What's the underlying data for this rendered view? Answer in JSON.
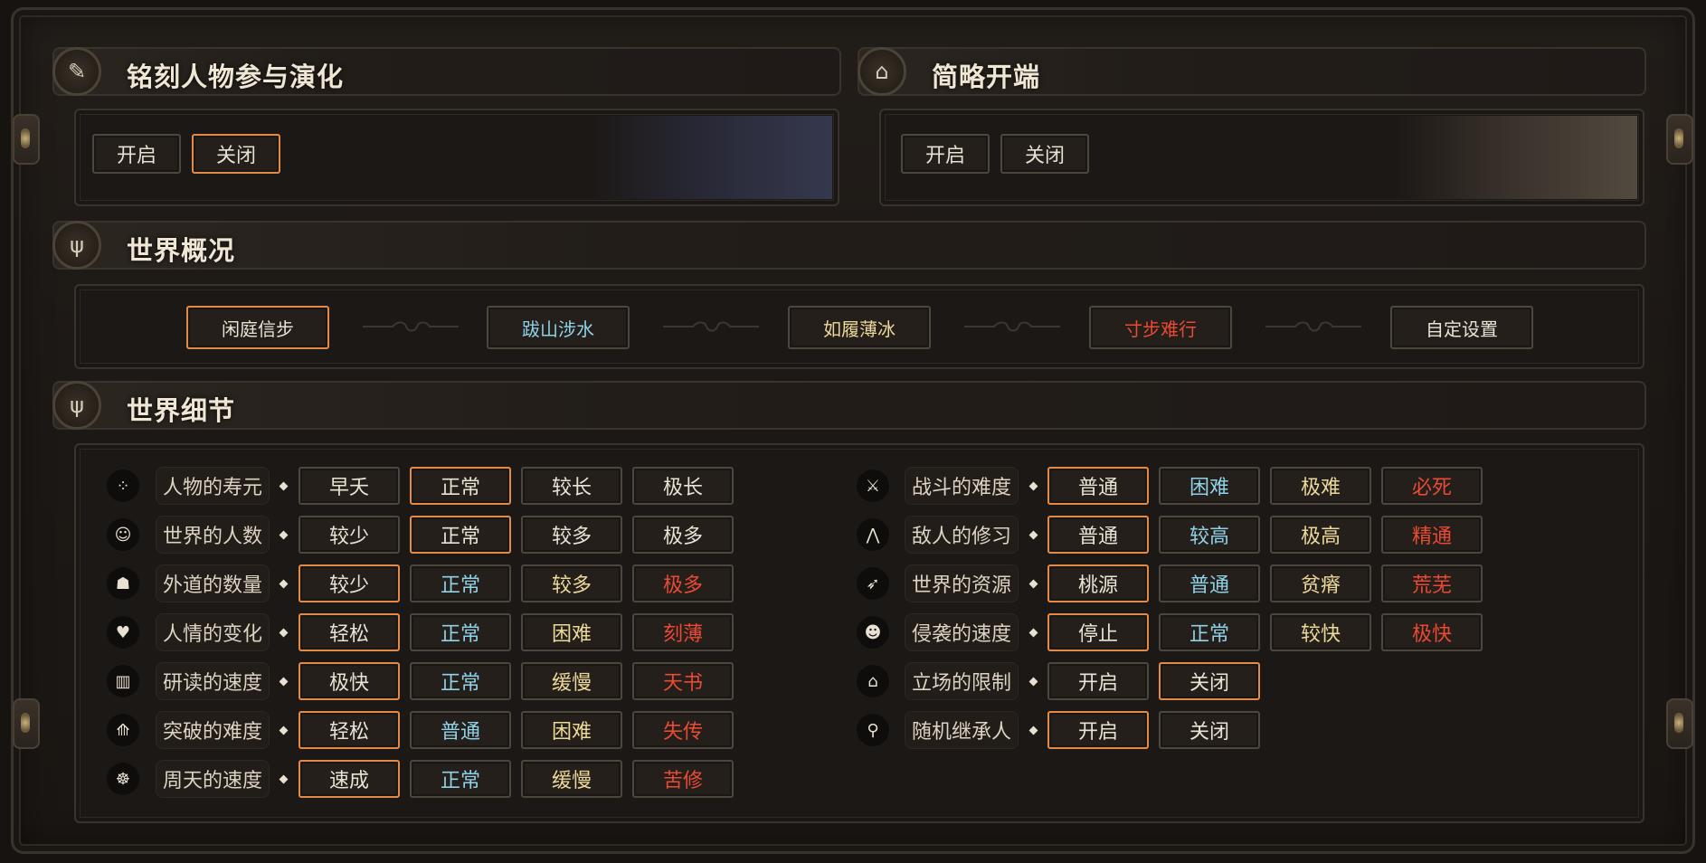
{
  "colors": {
    "selected_border": "#e48a49",
    "white": "#eae3d5",
    "blue": "#8fd2e8",
    "yellow": "#ecd89a",
    "red": "#ea4a34"
  },
  "engrave": {
    "title": "铭刻人物参与演化",
    "icon": "engraving-brush-icon",
    "buttons": [
      {
        "label": "开启",
        "selected": false
      },
      {
        "label": "关闭",
        "selected": true
      }
    ]
  },
  "brief": {
    "title": "简略开端",
    "icon": "temple-icon",
    "buttons": [
      {
        "label": "开启",
        "selected": false
      },
      {
        "label": "关闭",
        "selected": false
      }
    ]
  },
  "world_overview": {
    "title": "世界概况",
    "icon": "tree-icon",
    "difficulties": [
      {
        "label": "闲庭信步",
        "color": "white",
        "selected": true
      },
      {
        "label": "跋山涉水",
        "color": "blue",
        "selected": false
      },
      {
        "label": "如履薄冰",
        "color": "yellow",
        "selected": false
      },
      {
        "label": "寸步难行",
        "color": "red",
        "selected": false
      },
      {
        "label": "自定设置",
        "color": "white",
        "selected": false
      }
    ]
  },
  "world_details": {
    "title": "世界细节",
    "icon": "tree-icon",
    "left": [
      {
        "label": "人物的寿元",
        "icon": "dots-icon",
        "options": [
          {
            "label": "早夭",
            "color": "white",
            "selected": false
          },
          {
            "label": "正常",
            "color": "white",
            "selected": true
          },
          {
            "label": "较长",
            "color": "white",
            "selected": false
          },
          {
            "label": "极长",
            "color": "white",
            "selected": false
          }
        ]
      },
      {
        "label": "世界的人数",
        "icon": "person-icon",
        "options": [
          {
            "label": "较少",
            "color": "white",
            "selected": false
          },
          {
            "label": "正常",
            "color": "white",
            "selected": true
          },
          {
            "label": "较多",
            "color": "white",
            "selected": false
          },
          {
            "label": "极多",
            "color": "white",
            "selected": false
          }
        ]
      },
      {
        "label": "外道的数量",
        "icon": "demon-icon",
        "options": [
          {
            "label": "较少",
            "color": "white",
            "selected": true
          },
          {
            "label": "正常",
            "color": "blue",
            "selected": false
          },
          {
            "label": "较多",
            "color": "yellow",
            "selected": false
          },
          {
            "label": "极多",
            "color": "red",
            "selected": false
          }
        ]
      },
      {
        "label": "人情的变化",
        "icon": "heart-icon",
        "options": [
          {
            "label": "轻松",
            "color": "white",
            "selected": true
          },
          {
            "label": "正常",
            "color": "blue",
            "selected": false
          },
          {
            "label": "困难",
            "color": "yellow",
            "selected": false
          },
          {
            "label": "刻薄",
            "color": "red",
            "selected": false
          }
        ]
      },
      {
        "label": "研读的速度",
        "icon": "book-icon",
        "options": [
          {
            "label": "极快",
            "color": "white",
            "selected": true
          },
          {
            "label": "正常",
            "color": "blue",
            "selected": false
          },
          {
            "label": "缓慢",
            "color": "yellow",
            "selected": false
          },
          {
            "label": "天书",
            "color": "red",
            "selected": false
          }
        ]
      },
      {
        "label": "突破的难度",
        "icon": "breakthrough-icon",
        "options": [
          {
            "label": "轻松",
            "color": "white",
            "selected": true
          },
          {
            "label": "普通",
            "color": "blue",
            "selected": false
          },
          {
            "label": "困难",
            "color": "yellow",
            "selected": false
          },
          {
            "label": "失传",
            "color": "red",
            "selected": false
          }
        ]
      },
      {
        "label": "周天的速度",
        "icon": "meditation-icon",
        "options": [
          {
            "label": "速成",
            "color": "white",
            "selected": true
          },
          {
            "label": "正常",
            "color": "blue",
            "selected": false
          },
          {
            "label": "缓慢",
            "color": "yellow",
            "selected": false
          },
          {
            "label": "苦修",
            "color": "red",
            "selected": false
          }
        ]
      }
    ],
    "right": [
      {
        "label": "战斗的难度",
        "icon": "sword-icon",
        "options": [
          {
            "label": "普通",
            "color": "white",
            "selected": true
          },
          {
            "label": "困难",
            "color": "blue",
            "selected": false
          },
          {
            "label": "极难",
            "color": "yellow",
            "selected": false
          },
          {
            "label": "必死",
            "color": "red",
            "selected": false
          }
        ]
      },
      {
        "label": "敌人的修习",
        "icon": "mountain-icon",
        "options": [
          {
            "label": "普通",
            "color": "white",
            "selected": true
          },
          {
            "label": "较高",
            "color": "blue",
            "selected": false
          },
          {
            "label": "极高",
            "color": "yellow",
            "selected": false
          },
          {
            "label": "精通",
            "color": "red",
            "selected": false
          }
        ]
      },
      {
        "label": "世界的资源",
        "icon": "bird-icon",
        "options": [
          {
            "label": "桃源",
            "color": "white",
            "selected": true
          },
          {
            "label": "普通",
            "color": "blue",
            "selected": false
          },
          {
            "label": "贫瘠",
            "color": "yellow",
            "selected": false
          },
          {
            "label": "荒芜",
            "color": "red",
            "selected": false
          }
        ]
      },
      {
        "label": "侵袭的速度",
        "icon": "mask-icon",
        "options": [
          {
            "label": "停止",
            "color": "white",
            "selected": true
          },
          {
            "label": "正常",
            "color": "blue",
            "selected": false
          },
          {
            "label": "较快",
            "color": "yellow",
            "selected": false
          },
          {
            "label": "极快",
            "color": "red",
            "selected": false
          }
        ]
      },
      {
        "label": "立场的限制",
        "icon": "lock-icon",
        "options": [
          {
            "label": "开启",
            "color": "white",
            "selected": false
          },
          {
            "label": "关闭",
            "color": "white",
            "selected": true
          }
        ]
      },
      {
        "label": "随机继承人",
        "icon": "heir-icon",
        "options": [
          {
            "label": "开启",
            "color": "white",
            "selected": true
          },
          {
            "label": "关闭",
            "color": "white",
            "selected": false
          }
        ]
      }
    ]
  }
}
